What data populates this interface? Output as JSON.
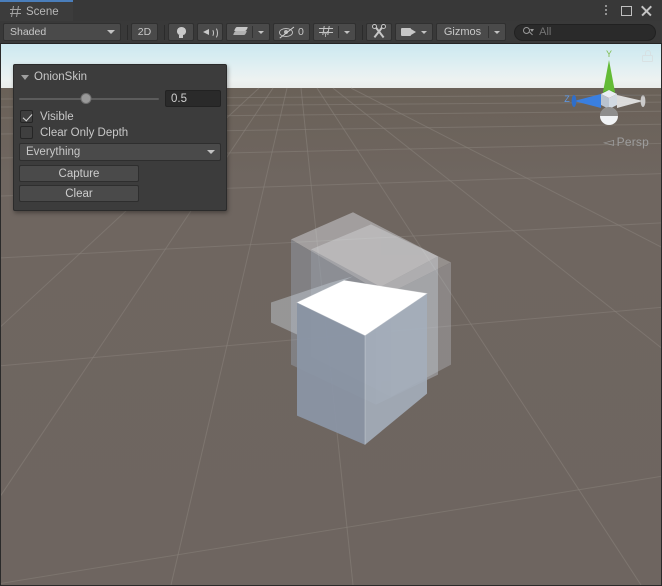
{
  "window": {
    "tab_label": "Scene",
    "tab_icon": "hash-grid-icon",
    "menu_icon": "kebab-menu-icon",
    "maximize_icon": "maximize-icon",
    "close_icon": "close-icon"
  },
  "toolbar": {
    "draw_mode": "Shaded",
    "toggle_2d": "2D",
    "lighting_icon": "lightbulb-icon",
    "audio_icon": "audio-speaker-icon",
    "fx_icon": "effects-layers-icon",
    "fx_caret": "chevron-down-icon",
    "hidden_objects_icon": "hidden-eye-icon",
    "hidden_objects_count": "0",
    "grid_icon": "grid-visibility-icon",
    "grid_caret": "chevron-down-icon",
    "scene_tools_icon": "scene-tools-icon",
    "camera_icon": "camera-icon",
    "camera_caret": "chevron-down-icon",
    "gizmos_label": "Gizmos",
    "gizmos_caret": "chevron-down-icon",
    "search_icon": "search-magnifier-icon",
    "search_value": "",
    "search_placeholder": "All"
  },
  "overlay": {
    "title": "OnionSkin",
    "foldout_icon": "foldout-triangle-down-icon",
    "opacity_value": "0.5",
    "opacity_slider_percent": 48,
    "visible_label": "Visible",
    "visible_checked": true,
    "clear_only_depth_label": "Clear Only Depth",
    "clear_only_depth_checked": false,
    "layer_mask": "Everything",
    "layer_mask_caret": "chevron-down-icon",
    "capture_button": "Capture",
    "clear_button": "Clear"
  },
  "scene_gizmo": {
    "axis_y_label": "Y",
    "axis_z_label": "Z",
    "projection_label": "Persp",
    "projection_arrow": "◅",
    "lock_icon": "lock-icon",
    "axis_y_color": "#6cc040",
    "axis_z_color": "#3a7fe0",
    "axis_x_color": "#e0e0e0",
    "center_color": "#cfd6dc"
  },
  "viewport": {
    "sky_top_color": "#cde8f0",
    "sky_horizon_color": "#e9ecea",
    "ground_color": "#6e6560",
    "grid_color": "#8a837c",
    "object_name": "onion-skin-cube",
    "cube_top_color": "#ffffff",
    "cube_left_color": "#8b96a6",
    "cube_right_color": "#a4aebb",
    "ghost_color": "#b9c2cd"
  }
}
